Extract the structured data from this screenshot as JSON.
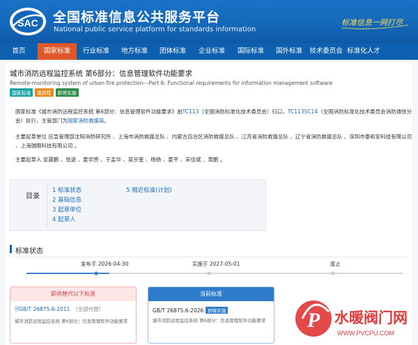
{
  "header": {
    "title": "全国标准信息公共服务平台",
    "subtitle": "National public service platform  for standards information",
    "logo_text": "SAC",
    "slogan": "标准信息一网打尽"
  },
  "nav": [
    {
      "label": "首页"
    },
    {
      "label": "国家标准"
    },
    {
      "label": "行业标准"
    },
    {
      "label": "地方标准"
    },
    {
      "label": "团体标准"
    },
    {
      "label": "企业标准"
    },
    {
      "label": "国际标准"
    },
    {
      "label": "国外标准"
    },
    {
      "label": "技术委员会"
    },
    {
      "label": "标准化人才"
    }
  ],
  "standard": {
    "title": "城市消防远程监控系统 第6部分：信息管理软件功能要求",
    "title_en": "Remote-monitoring system of urban fire protection---Part 6: Functional requirements for information management software",
    "badges": [
      "国家标准",
      "推荐性",
      "即将实施"
    ]
  },
  "intro": {
    "p1_a": "国家标准《城市消防远程监控系统 第6部分：信息管理软件功能要求》由",
    "p1_tc": "TC113",
    "p1_b": "（全国消防标准化技术委员会）归口，",
    "p1_sc": "TC113SC14",
    "p1_c": "（全国消防标准化技术委员会消防通信分会）执行，主管部门为",
    "p1_dept": "国家消防救援局",
    "p1_d": "。",
    "p2": "主要起草单位 应急管理部沈阳消防研究所 、上海市消防救援总队 、内蒙古自治区消防救援总队 、江苏省消防救援总队 、辽宁省消防救援总队 、深圳市泰和安科技有限公司 、上海瑞眼科技有限公司 。",
    "p3": "主要起草人 安震鹏 、张途 、姜学赟 、于孟华 、吴宗奎 、杨扬 、姜平 、宋佳斌 、黄鹏 。"
  },
  "toc": {
    "label": "目录",
    "items": [
      {
        "label": "1  标准状态"
      },
      {
        "label": "2  基础信息"
      },
      {
        "label": "3  起草单位"
      },
      {
        "label": "4  起草人"
      },
      {
        "label": "5  相近标准(计划)"
      }
    ]
  },
  "status": {
    "title": "标准状态",
    "timeline": [
      {
        "label": "发布于 2026-04-30"
      },
      {
        "label": "实施于 2027-05-01"
      },
      {
        "label": "废止"
      }
    ],
    "progress": 0.22,
    "replaced": {
      "head": "即将替代以下标准",
      "code": "GB/T 26875.6-2011",
      "note": "（全部代替）",
      "desc": "城市消防远程监控系统 第6部分：信息管理软件功能要求"
    },
    "current": {
      "head": "当前标准",
      "code": "GB/T 26875.6-2026",
      "tag": "即将实施",
      "desc": "城市消防远程监控系统 第6部分：信息管理软件功能要求"
    }
  },
  "watermark": {
    "brand": "水暖阀门网",
    "url": "WWW.PVCPU.COM",
    "letter": "P"
  },
  "colors": {
    "header_blue": "#1467b8",
    "nav_active": "#e0582a",
    "link": "#1467b8"
  }
}
